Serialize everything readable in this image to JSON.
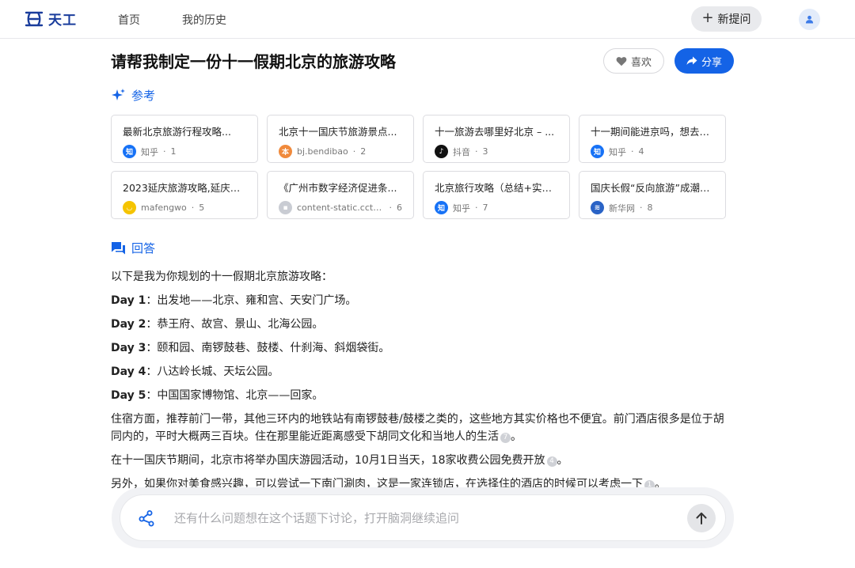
{
  "header": {
    "logo_text": "天工",
    "nav": [
      "首页",
      "我的历史"
    ],
    "new_question_label": "新提问"
  },
  "title": {
    "text": "请帮我制定一份十一假期北京的旅游攻略",
    "like_label": "喜欢",
    "share_label": "分享"
  },
  "references": {
    "heading": "参考",
    "items": [
      {
        "title": "最新北京旅游行程攻略...",
        "source": "知乎",
        "index": "1",
        "icon": "zhihu-icon",
        "icon_text": "知",
        "color": "#1772f6"
      },
      {
        "title": "北京十一国庆节旅游景点...",
        "source": "bj.bendibao",
        "index": "2",
        "icon": "bendibao-icon",
        "icon_text": "本",
        "color": "#f08a3c"
      },
      {
        "title": "十一旅游去哪里好北京 – ...",
        "source": "抖音",
        "index": "3",
        "icon": "douyin-icon",
        "icon_text": "♪",
        "color": "#111111"
      },
      {
        "title": "十一期间能进京吗，想去北...",
        "source": "知乎",
        "index": "4",
        "icon": "zhihu-icon",
        "icon_text": "知",
        "color": "#1772f6"
      },
      {
        "title": "2023延庆旅游攻略,延庆自...",
        "source": "mafengwo",
        "index": "5",
        "icon": "mafengwo-icon",
        "icon_text": "◡",
        "color": "#f5c400"
      },
      {
        "title": "《广州市数字经济促进条...",
        "source": "content-static.cctvn...",
        "index": "6",
        "icon": "cctv-icon",
        "icon_text": "▪",
        "color": "#c9ccd3"
      },
      {
        "title": "北京旅行攻略（总结+实践...",
        "source": "知乎",
        "index": "7",
        "icon": "zhihu-icon",
        "icon_text": "知",
        "color": "#1772f6"
      },
      {
        "title": "国庆长假“反向旅游”成潮流...",
        "source": "新华网",
        "index": "8",
        "icon": "xinhua-icon",
        "icon_text": "≋",
        "color": "#2a63c6"
      }
    ]
  },
  "answer": {
    "heading": "回答",
    "intro": "以下是我为你规划的十一假期北京旅游攻略：",
    "days": [
      {
        "label": "Day 1",
        "text": "：出发地——北京、雍和宫、天安门广场。"
      },
      {
        "label": "Day 2",
        "text": "：恭王府、故宫、景山、北海公园。"
      },
      {
        "label": "Day 3",
        "text": "：颐和园、南锣鼓巷、鼓楼、什刹海、斜烟袋街。"
      },
      {
        "label": "Day 4",
        "text": "：八达岭长城、天坛公园。"
      },
      {
        "label": "Day 5",
        "text": "：中国国家博物馆、北京——回家。"
      }
    ],
    "paragraphs": [
      {
        "text": "住宿方面，推荐前门一带，其他三环内的地铁站有南锣鼓巷/鼓楼之类的，这些地方其实价格也不便宜。前门酒店很多是位于胡同内的，平时大概两三百块。住在那里能近距离感受下胡同文化和当地人的生活",
        "cite": "7"
      },
      {
        "text": "在十一国庆节期间，北京市将举办国庆游园活动，10月1日当天，18家收费公园免费开放",
        "cite": "4"
      },
      {
        "text": "另外，如果你对美食感兴趣，可以尝试一下南门涮肉，这是一家连锁店，在选择住的酒店的时候可以考虑一下",
        "cite": "1"
      }
    ]
  },
  "input": {
    "placeholder": "还有什么问题想在这个话题下讨论，打开脑洞继续追问",
    "value": ""
  },
  "colors": {
    "accent": "#1463e6",
    "logo": "#1a3d9c"
  }
}
